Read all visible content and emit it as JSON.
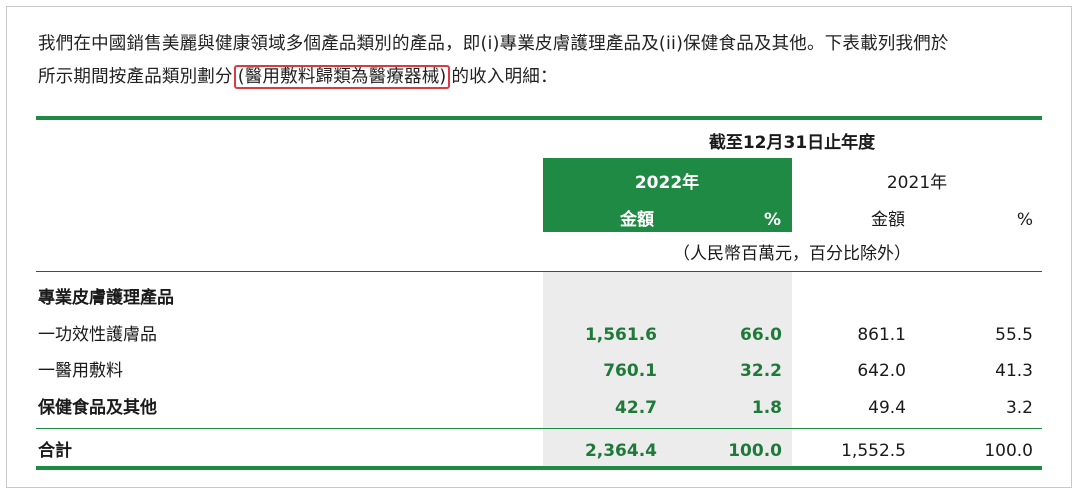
{
  "intro": {
    "line1": "我們在中國銷售美麗與健康領域多個產品類別的產品，即(i)專業皮膚護理產品及(ii)保健食品及其他。下表載列我們於",
    "line2_before": "所示期間按產品類別劃分",
    "line2_highlight": "(醫用敷料歸類為醫療器械)",
    "line2_after": "的收入明細："
  },
  "table": {
    "period_header": "截至12月31日止年度",
    "year_current": "2022年",
    "year_prior": "2021年",
    "amount_label": "金額",
    "percent_label": "%",
    "unit_note": "（人民幣百萬元，百分比除外）",
    "section_label": "專業皮膚護理產品",
    "rows": [
      {
        "label": "一功效性護膚品",
        "amt_2022": "1,561.6",
        "pct_2022": "66.0",
        "amt_2021": "861.1",
        "pct_2021": "55.5"
      },
      {
        "label": "一醫用敷料",
        "amt_2022": "760.1",
        "pct_2022": "32.2",
        "amt_2021": "642.0",
        "pct_2021": "41.3"
      },
      {
        "label": "保健食品及其他",
        "amt_2022": "42.7",
        "pct_2022": "1.8",
        "amt_2021": "49.4",
        "pct_2021": "3.2"
      }
    ],
    "total": {
      "label": "合計",
      "amt_2022": "2,364.4",
      "pct_2022": "100.0",
      "amt_2021": "1,552.5",
      "pct_2021": "100.0"
    }
  },
  "colors": {
    "accent_green": "#1f8a43",
    "highlight_red": "#d93a44",
    "shaded_column": "#ececec"
  }
}
